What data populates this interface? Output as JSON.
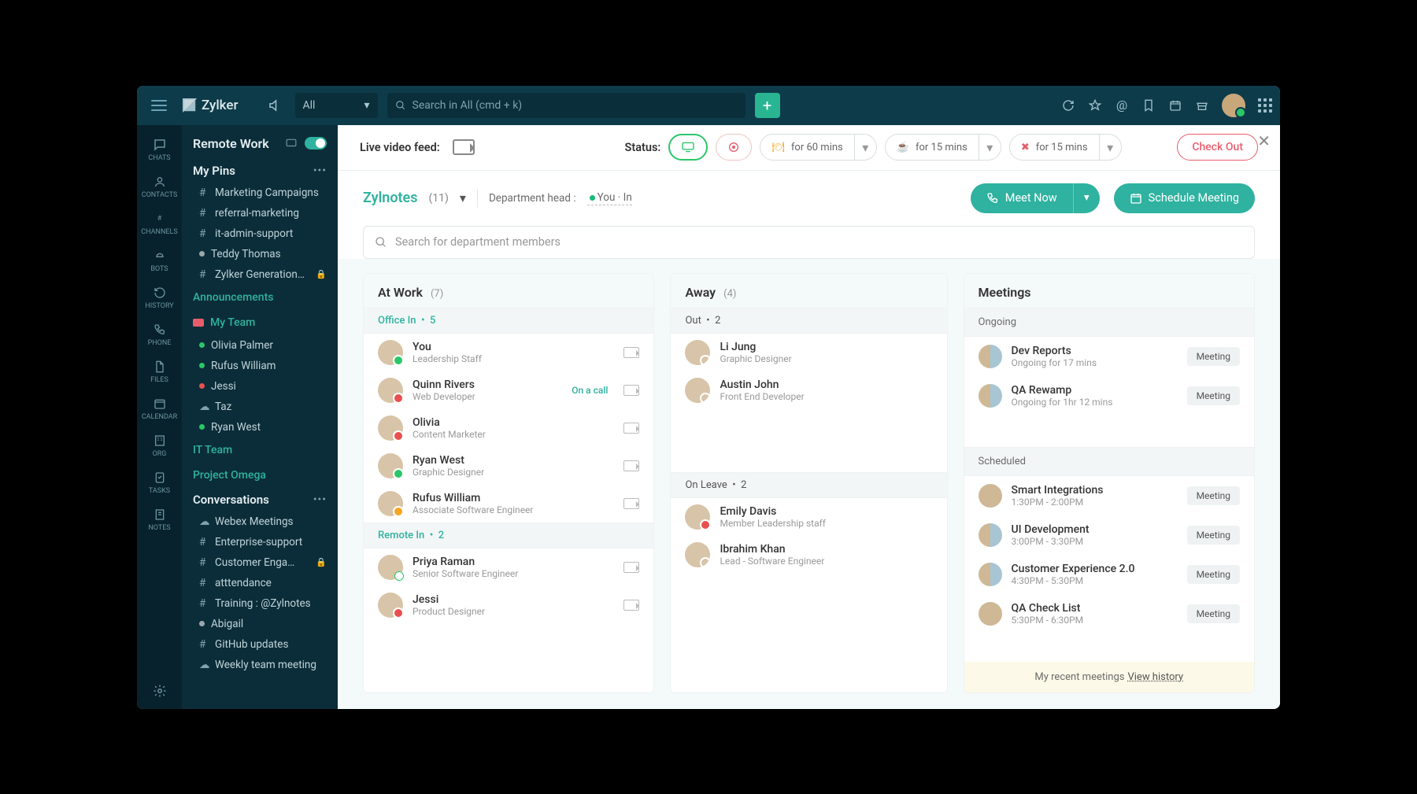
{
  "brand": "Zylker",
  "search_scope": "All",
  "search_placeholder": "Search in All (cmd + k)",
  "rail": [
    {
      "label": "CHATS"
    },
    {
      "label": "CONTACTS"
    },
    {
      "label": "CHANNELS"
    },
    {
      "label": "BOTS"
    },
    {
      "label": "HISTORY"
    },
    {
      "label": "PHONE"
    },
    {
      "label": "FILES"
    },
    {
      "label": "CALENDAR"
    },
    {
      "label": "ORG"
    },
    {
      "label": "TASKS"
    },
    {
      "label": "NOTES"
    }
  ],
  "sidebar": {
    "title": "Remote Work",
    "pins_title": "My Pins",
    "pins": [
      {
        "type": "hash",
        "label": "Marketing Campaigns"
      },
      {
        "type": "hash",
        "label": "referral-marketing"
      },
      {
        "type": "hash",
        "label": "it-admin-support"
      },
      {
        "type": "dot",
        "label": "Teddy Thomas",
        "dot": "#9aa9ad"
      },
      {
        "type": "hash",
        "label": "Zylker Generation…",
        "locked": true
      }
    ],
    "announcements": "Announcements",
    "myteam": "My Team",
    "team_members": [
      {
        "dot": "#2ac769",
        "label": "Olivia Palmer"
      },
      {
        "dot": "#2ac769",
        "label": "Rufus William"
      },
      {
        "dot": "#e8504f",
        "label": "Jessi"
      },
      {
        "dot": "cloud",
        "label": "Taz"
      },
      {
        "dot": "#2ac769",
        "label": "Ryan West"
      }
    ],
    "it_team": "IT Team",
    "project": "Project Omega",
    "conversations_title": "Conversations",
    "conversations": [
      {
        "type": "cloud",
        "label": "Webex Meetings"
      },
      {
        "type": "hash",
        "label": "Enterprise-support"
      },
      {
        "type": "hash",
        "label": "Customer Enga…",
        "locked": true
      },
      {
        "type": "hash",
        "label": "atttendance"
      },
      {
        "type": "hash",
        "label": "Training : @Zylnotes"
      },
      {
        "type": "dot",
        "label": "Abigail",
        "dot": "#9aa9ad"
      },
      {
        "type": "hash",
        "label": "GitHub updates"
      },
      {
        "type": "cloud",
        "label": "Weekly team meeting"
      }
    ]
  },
  "status_bar": {
    "feed_label": "Live video feed:",
    "status_label": "Status:",
    "away60": "for 60 mins",
    "away15": "for 15 mins",
    "dnd15": "for 15 mins",
    "checkout": "Check Out"
  },
  "dept": {
    "name": "Zylnotes",
    "count": "(11)",
    "head_label": "Department head :",
    "head_you": "You",
    "head_status": "In",
    "meet_now": "Meet Now",
    "schedule": "Schedule Meeting",
    "search_placeholder": "Search for department members"
  },
  "atwork": {
    "title": "At Work",
    "count": "(7)",
    "office_in": "Office In",
    "office_in_count": "5",
    "remote_in": "Remote In",
    "remote_in_count": "2",
    "office": [
      {
        "name": "You",
        "role": "Leadership Staff",
        "st": "green"
      },
      {
        "name": "Quinn Rivers",
        "role": "Web Developer",
        "st": "red",
        "oncall": "On a call"
      },
      {
        "name": "Olivia",
        "role": "Content Marketer",
        "st": "red"
      },
      {
        "name": "Ryan West",
        "role": "Graphic Designer",
        "st": "green"
      },
      {
        "name": "Rufus William",
        "role": "Associate Software Engineer",
        "st": "orange"
      }
    ],
    "remote": [
      {
        "name": "Priya Raman",
        "role": "Senior Software Engineer",
        "st": "home"
      },
      {
        "name": "Jessi",
        "role": "Product Designer",
        "st": "red"
      }
    ]
  },
  "away": {
    "title": "Away",
    "count": "(4)",
    "out": "Out",
    "out_count": "2",
    "leave": "On Leave",
    "leave_count": "2",
    "out_list": [
      {
        "name": "Li Jung",
        "role": "Graphic Designer"
      },
      {
        "name": "Austin John",
        "role": "Front End Developer"
      }
    ],
    "leave_list": [
      {
        "name": "Emily Davis",
        "role": "Member Leadership staff",
        "st": "red"
      },
      {
        "name": "Ibrahim Khan",
        "role": "Lead - Software Engineer"
      }
    ]
  },
  "meetings": {
    "title": "Meetings",
    "ongoing": "Ongoing",
    "scheduled": "Scheduled",
    "btn": "Meeting",
    "ongoing_list": [
      {
        "name": "Dev Reports",
        "time": "Ongoing for 17 mins"
      },
      {
        "name": "QA Rewamp",
        "time": "Ongoing for 1hr 12 mins"
      }
    ],
    "scheduled_list": [
      {
        "name": "Smart Integrations",
        "time": "1:30PM - 2:00PM"
      },
      {
        "name": "UI Development",
        "time": "3:00PM - 3:30PM"
      },
      {
        "name": "Customer Experience 2.0",
        "time": "4:30PM - 5:30PM"
      },
      {
        "name": "QA Check List",
        "time": "5:30PM - 6:30PM"
      }
    ],
    "recent": "My recent meetings",
    "view_history": "View history"
  }
}
